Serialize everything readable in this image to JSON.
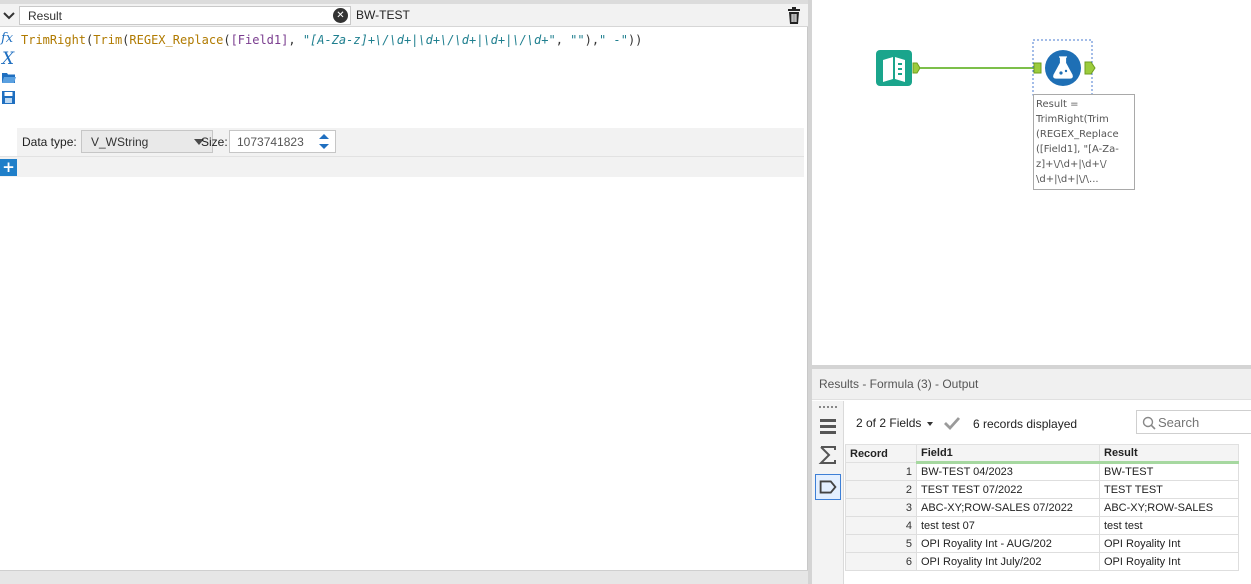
{
  "config": {
    "output_field": "Result",
    "preview_value": "BW-TEST",
    "expression_tokens": [
      {
        "t": "TrimRight",
        "c": "fn"
      },
      {
        "t": "(",
        "c": "pn"
      },
      {
        "t": "Trim",
        "c": "fn"
      },
      {
        "t": "(",
        "c": "pn"
      },
      {
        "t": "REGEX_Replace",
        "c": "fn"
      },
      {
        "t": "(",
        "c": "pn"
      },
      {
        "t": "[Field1]",
        "c": "fd"
      },
      {
        "t": ", ",
        "c": "pn"
      },
      {
        "t": "\"[A-Za-z]+\\/\\d+|\\d+\\/\\d+|\\d+|\\/\\d+\"",
        "c": "st"
      },
      {
        "t": ", ",
        "c": "pn"
      },
      {
        "t": "\"\"",
        "c": "st"
      },
      {
        "t": "),",
        "c": "pn"
      },
      {
        "t": "\" -\"",
        "c": "st"
      },
      {
        "t": "))",
        "c": "pn"
      }
    ],
    "data_type_label": "Data type:",
    "data_type_value": "V_WString",
    "size_label": "Size:",
    "size_value": "1073741823",
    "icons": [
      "chevron-down-icon",
      "clear-icon",
      "trash-icon",
      "function-icon",
      "variable-icon",
      "open-folder-icon",
      "save-icon",
      "add-icon"
    ]
  },
  "canvas": {
    "annotation": "Result =\nTrimRight(Trim\n(REGEX_Replace\n([Field1], \"[A-Za-\nz]+\\/\\d+|\\d+\\/\n\\d+|\\d+|\\/\\...",
    "tools": [
      "input-data-tool",
      "formula-tool"
    ],
    "colors": {
      "input_tool": "#1aa58c",
      "formula_tool": "#1e6fb5",
      "connector": "#8bc34a"
    }
  },
  "results": {
    "title": "Results - Formula (3) - Output",
    "fields_selector": "2 of 2 Fields",
    "records_label": "6 records displayed",
    "search_placeholder": "Search",
    "columns": [
      "Record",
      "Field1",
      "Result"
    ],
    "rows": [
      {
        "record": "1",
        "field1": "BW-TEST 04/2023",
        "result": "BW-TEST"
      },
      {
        "record": "2",
        "field1": "TEST TEST 07/2022",
        "result": "TEST TEST"
      },
      {
        "record": "3",
        "field1": "ABC-XY;ROW-SALES 07/2022",
        "result": "ABC-XY;ROW-SALES"
      },
      {
        "record": "4",
        "field1": "test test 07",
        "result": "test test"
      },
      {
        "record": "5",
        "field1": "OPI Royality Int - AUG/202",
        "result": "OPI Royality Int"
      },
      {
        "record": "6",
        "field1": "OPI Royality Int July/202",
        "result": "OPI Royality Int"
      }
    ]
  }
}
